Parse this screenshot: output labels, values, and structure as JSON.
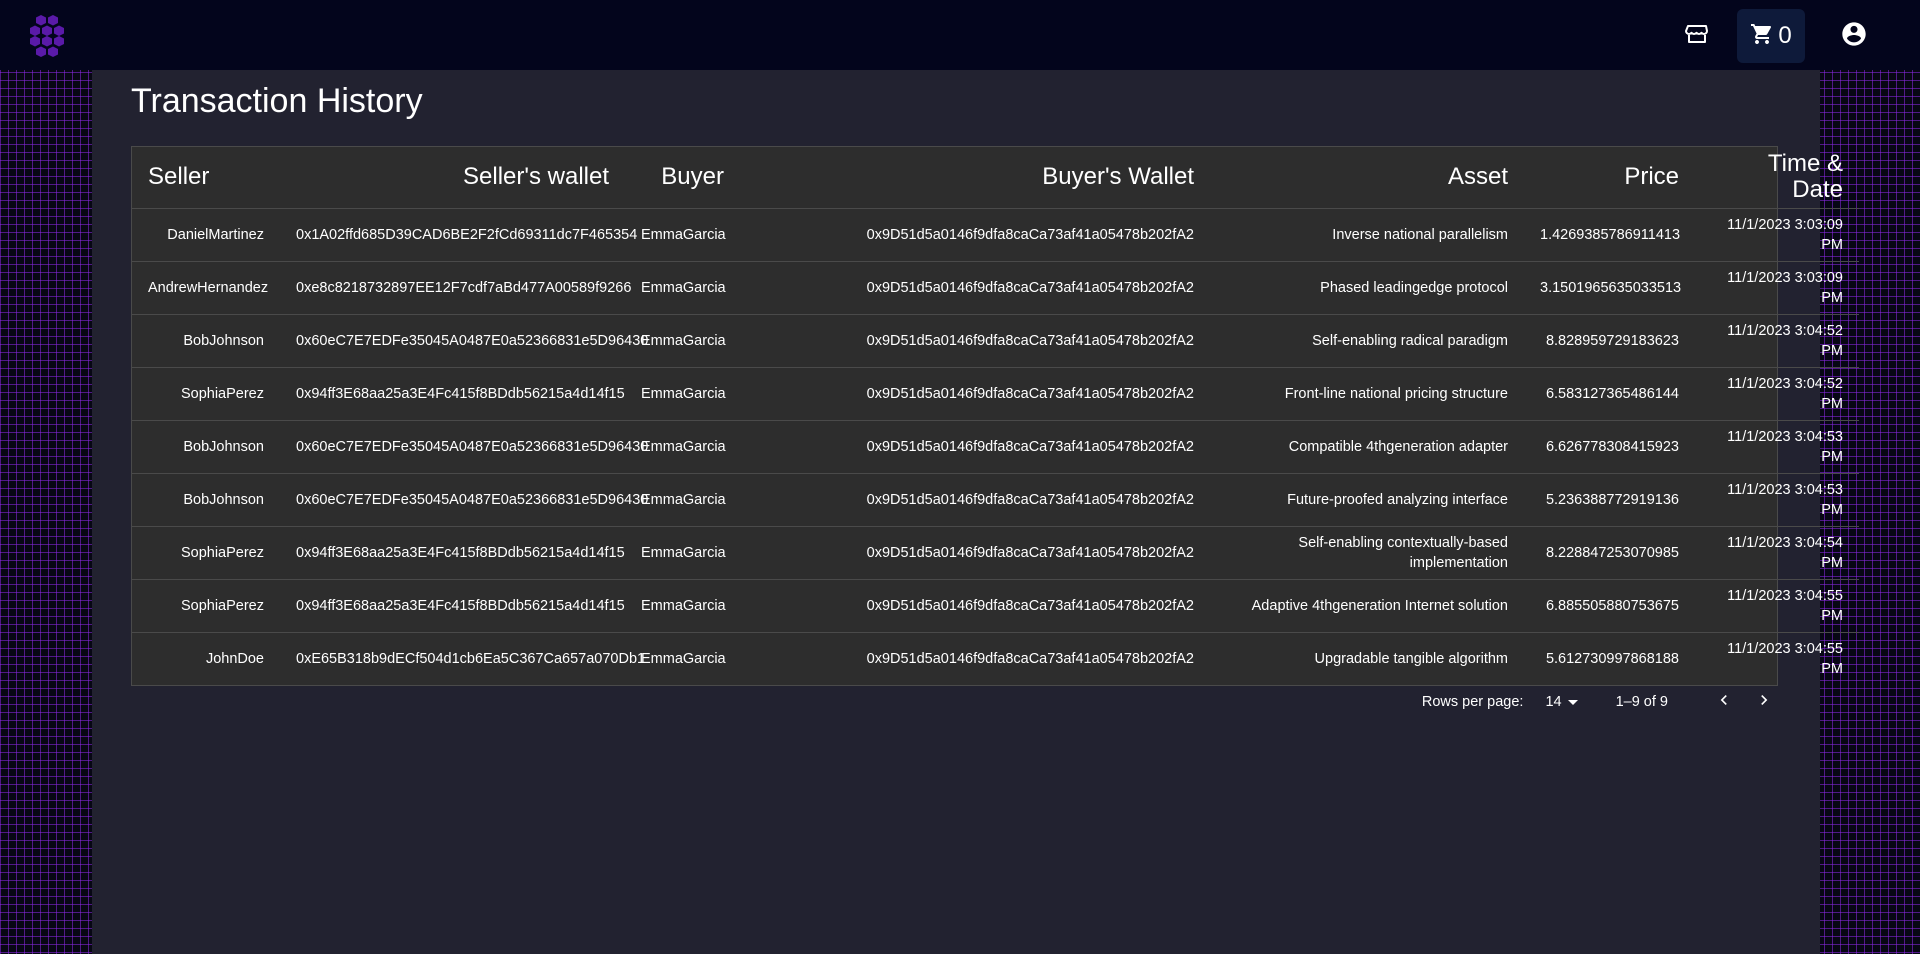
{
  "header": {
    "logo_icon": "hexagon-logo-icon",
    "store_icon": "storefront-icon",
    "cart_icon": "shopping-cart-icon",
    "cart_count": "0",
    "account_icon": "account-circle-icon",
    "logo_color": "#5a1aa8",
    "background_color": "#03051c"
  },
  "page": {
    "title": "Transaction History"
  },
  "table": {
    "columns": [
      "Seller",
      "Seller's wallet",
      "Buyer",
      "Buyer's Wallet",
      "Asset",
      "Price",
      "Time & Date"
    ],
    "rows": [
      [
        "DanielMartinez",
        "0x1A02ffd685D39CAD6BE2F2fCd69311dc7F465354",
        "EmmaGarcia",
        "0x9D51d5a0146f9dfa8caCa73af41a05478b202fA2",
        "Inverse national parallelism",
        "1.4269385786911413",
        "11/1/2023 3:03:09 PM"
      ],
      [
        "AndrewHernandez",
        "0xe8c8218732897EE12F7cdf7aBd477A00589f9266",
        "EmmaGarcia",
        "0x9D51d5a0146f9dfa8caCa73af41a05478b202fA2",
        "Phased leadingedge protocol",
        "3.1501965635033513",
        "11/1/2023 3:03:09 PM"
      ],
      [
        "BobJohnson",
        "0x60eC7E7EDFe35045A0487E0a52366831e5D96430",
        "EmmaGarcia",
        "0x9D51d5a0146f9dfa8caCa73af41a05478b202fA2",
        "Self-enabling radical paradigm",
        "8.828959729183623",
        "11/1/2023 3:04:52 PM"
      ],
      [
        "SophiaPerez",
        "0x94ff3E68aa25a3E4Fc415f8BDdb56215a4d14f15",
        "EmmaGarcia",
        "0x9D51d5a0146f9dfa8caCa73af41a05478b202fA2",
        "Front-line national pricing structure",
        "6.583127365486144",
        "11/1/2023 3:04:52 PM"
      ],
      [
        "BobJohnson",
        "0x60eC7E7EDFe35045A0487E0a52366831e5D96430",
        "EmmaGarcia",
        "0x9D51d5a0146f9dfa8caCa73af41a05478b202fA2",
        "Compatible 4thgeneration adapter",
        "6.626778308415923",
        "11/1/2023 3:04:53 PM"
      ],
      [
        "BobJohnson",
        "0x60eC7E7EDFe35045A0487E0a52366831e5D96430",
        "EmmaGarcia",
        "0x9D51d5a0146f9dfa8caCa73af41a05478b202fA2",
        "Future-proofed analyzing interface",
        "5.236388772919136",
        "11/1/2023 3:04:53 PM"
      ],
      [
        "SophiaPerez",
        "0x94ff3E68aa25a3E4Fc415f8BDdb56215a4d14f15",
        "EmmaGarcia",
        "0x9D51d5a0146f9dfa8caCa73af41a05478b202fA2",
        "Self-enabling contextually-based implementation",
        "8.228847253070985",
        "11/1/2023 3:04:54 PM"
      ],
      [
        "SophiaPerez",
        "0x94ff3E68aa25a3E4Fc415f8BDdb56215a4d14f15",
        "EmmaGarcia",
        "0x9D51d5a0146f9dfa8caCa73af41a05478b202fA2",
        "Adaptive 4thgeneration Internet solution",
        "6.885505880753675",
        "11/1/2023 3:04:55 PM"
      ],
      [
        "JohnDoe",
        "0xE65B318b9dECf504d1cb6Ea5C367Ca657a070Db1",
        "EmmaGarcia",
        "0x9D51d5a0146f9dfa8caCa73af41a05478b202fA2",
        "Upgradable tangible algorithm",
        "5.612730997868188",
        "11/1/2023 3:04:55 PM"
      ]
    ]
  },
  "pagination": {
    "rows_per_page_label": "Rows per page:",
    "rows_per_page_value": "14",
    "range_text": "1–9 of 9",
    "prev_icon": "chevron-left-icon",
    "next_icon": "chevron-right-icon"
  }
}
